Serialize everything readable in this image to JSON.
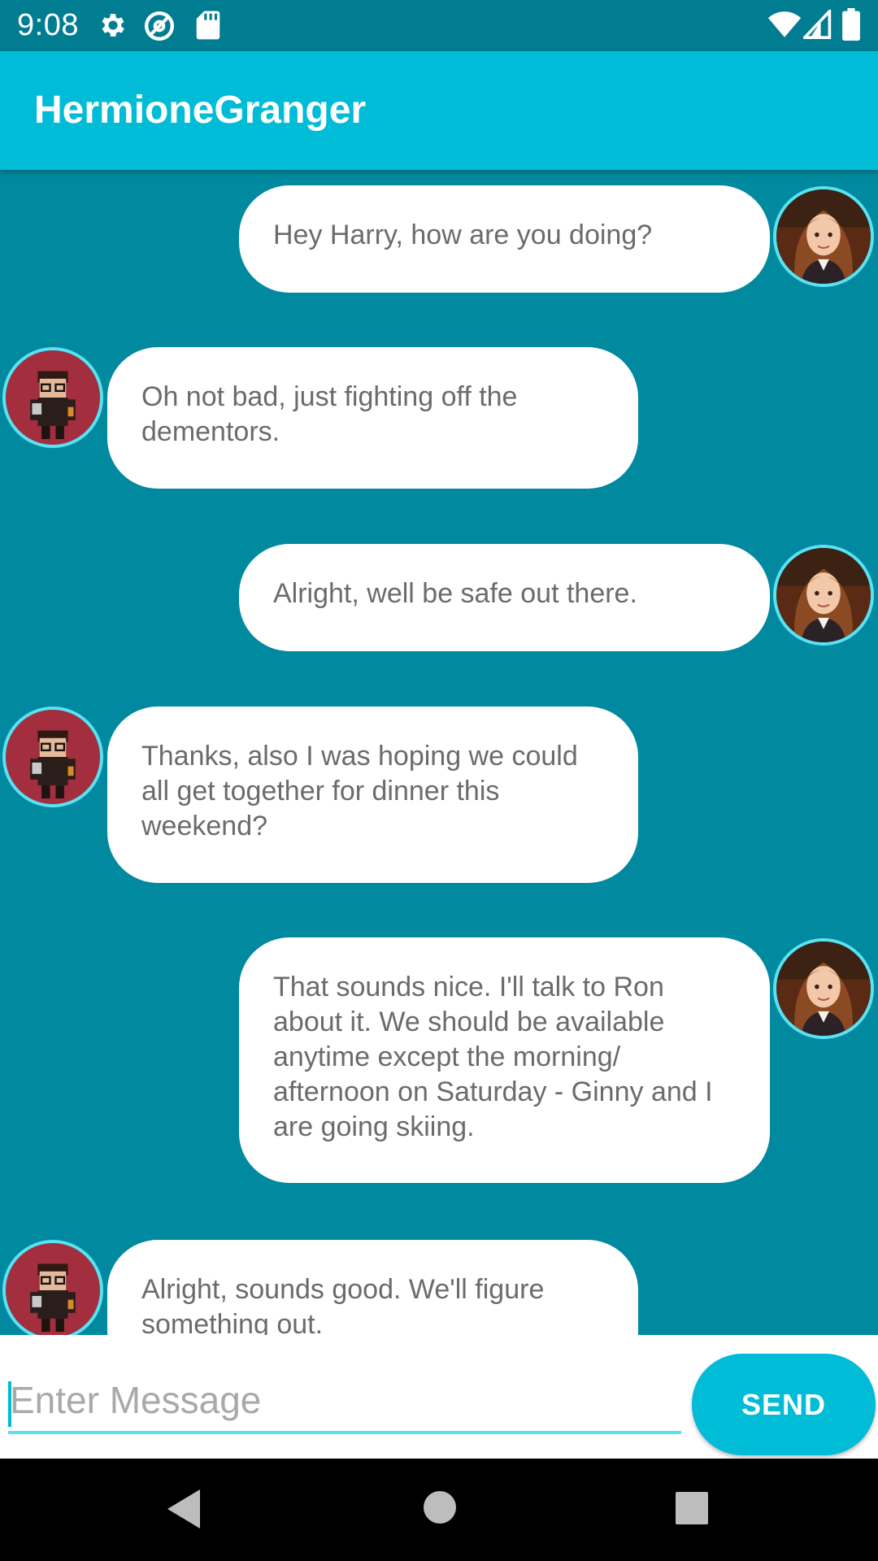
{
  "status_bar": {
    "time": "9:08",
    "icons_left": [
      "gear-icon",
      "at-sign-icon",
      "sd-card-icon"
    ],
    "icons_right": [
      "wifi-icon",
      "cell-signal-icon",
      "battery-icon"
    ]
  },
  "app_bar": {
    "title": "HermioneGranger"
  },
  "messages": [
    {
      "sender": "Hermione",
      "side": "right",
      "text": "Hey Harry, how are you doing?"
    },
    {
      "sender": "Harry",
      "side": "left",
      "text": "Oh not bad, just fighting off the dementors."
    },
    {
      "sender": "Hermione",
      "side": "right",
      "text": "Alright, well be safe out there."
    },
    {
      "sender": "Harry",
      "side": "left",
      "text": "Thanks, also I was hoping we could all get together for dinner this weekend?"
    },
    {
      "sender": "Hermione",
      "side": "right",
      "text": "That sounds nice. I'll talk to Ron about it. We should be available anytime except the morning/ afternoon on Saturday - Ginny and I are going skiing."
    },
    {
      "sender": "Harry",
      "side": "left",
      "text": "Alright, sounds good. We'll figure something out."
    }
  ],
  "composer": {
    "placeholder": "Enter Message",
    "value": "",
    "send_label": "SEND"
  },
  "nav_bar": {
    "buttons": [
      "back-icon",
      "home-icon",
      "recents-icon"
    ]
  },
  "colors": {
    "status_bar": "#017d92",
    "app_bar": "#00bcd6",
    "chat_background": "#01899f",
    "bubble": "#ffffff",
    "bubble_text": "#6b6b6b",
    "avatar_border": "#5ce1f2",
    "send_button": "#00bcd6"
  }
}
